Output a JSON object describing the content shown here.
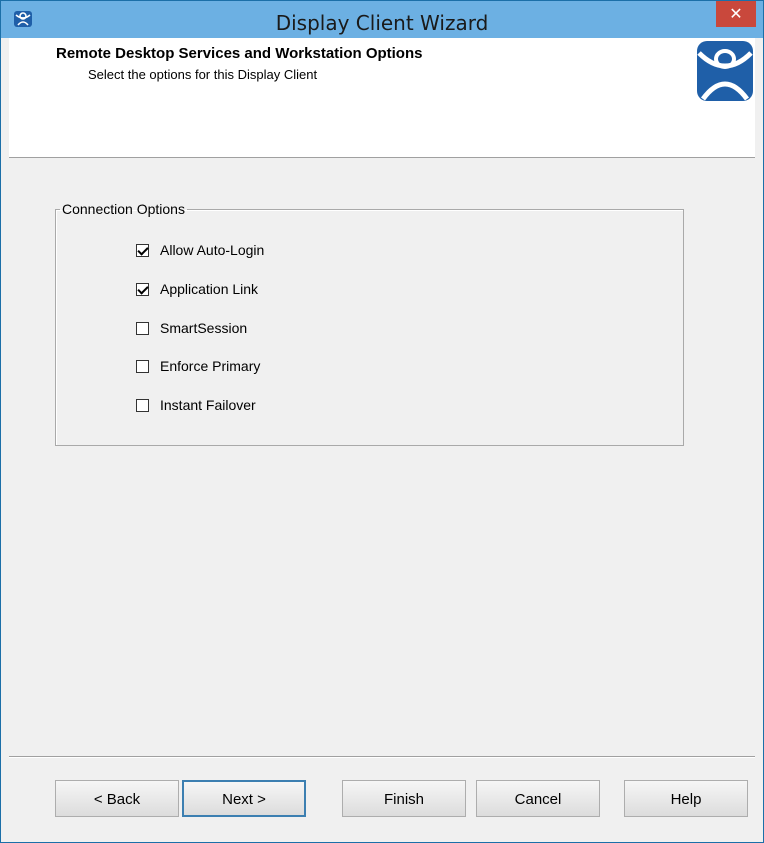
{
  "window": {
    "title": "Display Client Wizard",
    "close_glyph": "✕",
    "app_icon": "thinmanager-icon"
  },
  "header": {
    "title": "Remote Desktop Services and Workstation Options",
    "subtitle": "Select the options for this Display Client",
    "logo": "thinmanager-logo",
    "logo_color": "#1f5fa8"
  },
  "connection_options": {
    "legend": "Connection Options",
    "options": [
      {
        "label": "Allow Auto-Login",
        "checked": true
      },
      {
        "label": "Application Link",
        "checked": true
      },
      {
        "label": "SmartSession",
        "checked": false
      },
      {
        "label": "Enforce Primary",
        "checked": false
      },
      {
        "label": "Instant Failover",
        "checked": false
      }
    ]
  },
  "buttons": {
    "back": "< Back",
    "next": "Next >",
    "finish": "Finish",
    "cancel": "Cancel",
    "help": "Help"
  },
  "colors": {
    "titlebar": "#6cb0e3",
    "close": "#c9483c",
    "default_button_border": "#3c7fb1"
  }
}
